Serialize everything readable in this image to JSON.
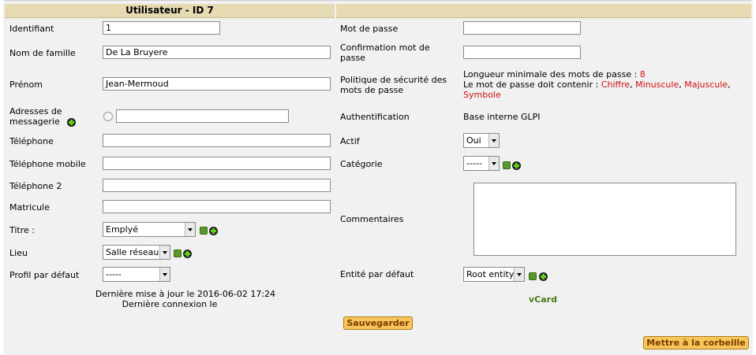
{
  "header": {
    "left_title": "Utilisateur - ID 7",
    "right_title": ""
  },
  "left": {
    "identifiant": {
      "label": "Identifiant",
      "value": "1"
    },
    "nom": {
      "label": "Nom de famille",
      "value": "De La Bruyere"
    },
    "prenom": {
      "label": "Prénom",
      "value": "Jean-Mermoud"
    },
    "emails": {
      "label": "Adresses de messagerie",
      "value": ""
    },
    "telephone": {
      "label": "Téléphone",
      "value": ""
    },
    "mobile": {
      "label": "Téléphone mobile",
      "value": ""
    },
    "telephone2": {
      "label": "Téléphone 2",
      "value": ""
    },
    "matricule": {
      "label": "Matricule",
      "value": ""
    },
    "titre": {
      "label": "Titre :",
      "value": "Emplyé"
    },
    "lieu": {
      "label": "Lieu",
      "value": "Salle réseau"
    },
    "profil": {
      "label": "Profil par défaut",
      "value": "-----"
    },
    "last_update": "Dernière mise à jour le 2016-06-02 17:24",
    "last_login": "Dernière connexion le"
  },
  "right": {
    "password": {
      "label": "Mot de passe",
      "value": ""
    },
    "password_confirm": {
      "label": "Confirmation mot de passe",
      "value": ""
    },
    "policy": {
      "label": "Politique de sécurité des mots de passe",
      "min_length_text": "Longueur minimale des mots de passe :",
      "min_length_value": "8",
      "must_contain_text": "Le mot de passe doit contenir :",
      "chiffre": "Chiffre",
      "minuscule": "Minuscule",
      "majuscule": "Majuscule",
      "symbole": "Symbole"
    },
    "auth": {
      "label": "Authentification",
      "value": "Base interne GLPI"
    },
    "actif": {
      "label": "Actif",
      "value": "Oui"
    },
    "categorie": {
      "label": "Catégorie",
      "value": "-----"
    },
    "commentaires": {
      "label": "Commentaires",
      "value": ""
    },
    "entite": {
      "label": "Entité par défaut",
      "value": "Root entity"
    },
    "vcard": "vCard"
  },
  "buttons": {
    "save": "Sauvegarder",
    "trash": "Mettre à la corbeille"
  },
  "colors": {
    "header_bg": "#e6dab3",
    "button_bg": "#f8c55a",
    "policy_red": "#d01010",
    "vcard_green": "#4a7a12"
  }
}
